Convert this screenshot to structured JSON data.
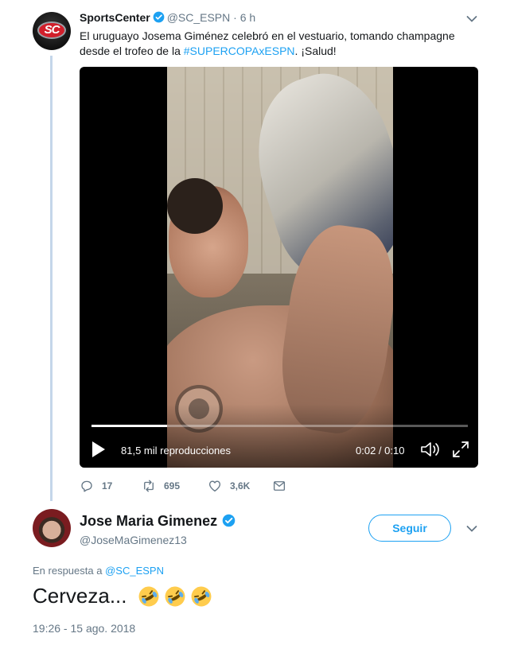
{
  "tweet": {
    "display_name": "SportsCenter",
    "handle": "@SC_ESPN",
    "separator": "·",
    "time": "6 h",
    "text_before": "El uruguayo Josema Giménez celebró en el vestuario, tomando champagne desde el trofeo de la ",
    "hashtag": "#SUPERCOPAxESPN",
    "text_after": ". ¡Salud!",
    "avatar_text": "SC",
    "video": {
      "views": "81,5 mil reproducciones",
      "duration": "0:02 / 0:10",
      "progress_fraction": 0.2
    },
    "actions": {
      "replies": "17",
      "retweets": "695",
      "likes": "3,6K"
    }
  },
  "reply": {
    "display_name": "Jose Maria Gimenez",
    "handle": "@JoseMaGimenez13",
    "follow_label": "Seguir",
    "in_reply_prefix": "En respuesta a",
    "in_reply_mention": "@SC_ESPN",
    "text": "Cerveza...",
    "emoji": [
      "rolling-on-the-floor-laughing",
      "rolling-on-the-floor-laughing",
      "rolling-on-the-floor-laughing"
    ],
    "timestamp": "19:26 - 15 ago. 2018"
  },
  "colors": {
    "accent": "#1da1f2",
    "secondary_text": "#657786",
    "thread_line": "#c4d6ea"
  }
}
